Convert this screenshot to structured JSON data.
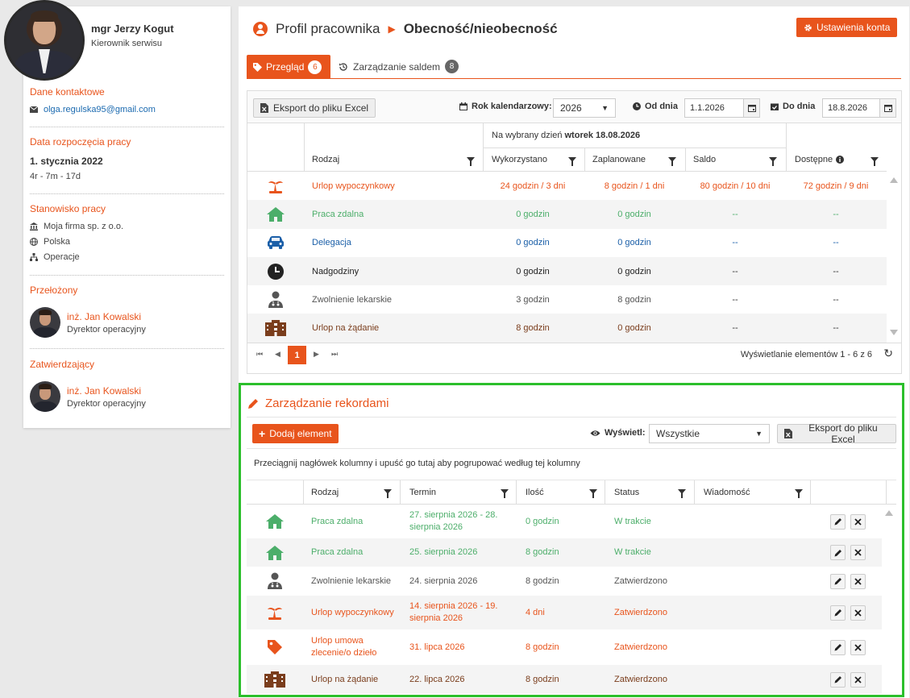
{
  "profile": {
    "name": "mgr Jerzy Kogut",
    "role": "Kierownik serwisu",
    "contact_title": "Dane kontaktowe",
    "email": "olga.regulska95@gmail.com",
    "start_title": "Data rozpoczęcia pracy",
    "start_date": "1. stycznia 2022",
    "tenure": "4r - 7m - 17d",
    "position_title": "Stanowisko pracy",
    "company": "Moja firma sp. z o.o.",
    "country": "Polska",
    "department": "Operacje",
    "supervisor_title": "Przełożony",
    "supervisor_name": "inż. Jan Kowalski",
    "supervisor_role": "Dyrektor operacyjny",
    "approver_title": "Zatwierdzający",
    "approver_name": "inż. Jan Kowalski",
    "approver_role": "Dyrektor operacyjny"
  },
  "header": {
    "section": "Profil pracownika",
    "page": "Obecność/nieobecność",
    "settings_label": "Ustawienia konta"
  },
  "tabs": {
    "overview_label": "Przegląd",
    "overview_count": "6",
    "balance_label": "Zarządzanie saldem",
    "balance_count": "8"
  },
  "overview": {
    "export_label": "Eksport do pliku Excel",
    "year_label": "Rok kalendarzowy:",
    "year_value": "2026",
    "from_label": "Od dnia",
    "from_value": "1.1.2026",
    "to_label": "Do dnia",
    "to_value": "18.8.2026",
    "day_prefix": "Na wybrany dzień ",
    "day_value": "wtorek 18.08.2026",
    "columns": [
      "Rodzaj",
      "Wykorzystano",
      "Zaplanowane",
      "Saldo",
      "Dostępne"
    ],
    "rows": [
      {
        "icon": "palm-tree-icon",
        "color": "#e8541c",
        "name": "Urlop wypoczynkowy",
        "used": "24 godzin / 3 dni",
        "planned": "8 godzin / 1 dni",
        "balance": "80 godzin / 10 dni",
        "available": "72 godzin / 9 dni"
      },
      {
        "icon": "house-icon",
        "color": "#4cae6a",
        "name": "Praca zdalna",
        "used": "0 godzin",
        "planned": "0 godzin",
        "balance": "--",
        "available": "--"
      },
      {
        "icon": "car-icon",
        "color": "#1b5fa8",
        "name": "Delegacja",
        "used": "0 godzin",
        "planned": "0 godzin",
        "balance": "--",
        "available": "--"
      },
      {
        "icon": "clock-icon",
        "color": "#222222",
        "name": "Nadgodziny",
        "used": "0 godzin",
        "planned": "0 godzin",
        "balance": "--",
        "available": "--"
      },
      {
        "icon": "doctor-icon",
        "color": "#555555",
        "name": "Zwolnienie lekarskie",
        "used": "3 godzin",
        "planned": "8 godzin",
        "balance": "--",
        "available": "--"
      },
      {
        "icon": "hotel-icon",
        "color": "#7a3d1c",
        "name": "Urlop na żądanie",
        "used": "8 godzin",
        "planned": "0 godzin",
        "balance": "--",
        "available": "--"
      }
    ],
    "current_page": "1",
    "page_info": "Wyświetlanie elementów 1 - 6 z 6"
  },
  "records": {
    "title": "Zarządzanie rekordami",
    "add_label": "Dodaj element",
    "show_label": "Wyświetl:",
    "show_value": "Wszystkie",
    "export_label": "Eksport do pliku Excel",
    "group_hint": "Przeciągnij nagłówek kolumny i upuść go tutaj aby pogrupować według tej kolumny",
    "columns": [
      "Rodzaj",
      "Termin",
      "Ilość",
      "Status",
      "Wiadomość"
    ],
    "rows": [
      {
        "icon": "house-icon",
        "color": "#4cae6a",
        "name": "Praca zdalna",
        "term": "27. sierpnia 2026 - 28. sierpnia 2026",
        "qty": "0 godzin",
        "status": "W trakcie"
      },
      {
        "icon": "house-icon",
        "color": "#4cae6a",
        "name": "Praca zdalna",
        "term": "25. sierpnia 2026",
        "qty": "8 godzin",
        "status": "W trakcie"
      },
      {
        "icon": "doctor-icon",
        "color": "#555555",
        "name": "Zwolnienie lekarskie",
        "term": "24. sierpnia 2026",
        "qty": "8 godzin",
        "status": "Zatwierdzono"
      },
      {
        "icon": "palm-tree-icon",
        "color": "#e8541c",
        "name": "Urlop wypoczynkowy",
        "term": "14. sierpnia 2026 - 19. sierpnia 2026",
        "qty": "4 dni",
        "status": "Zatwierdzono"
      },
      {
        "icon": "tag-icon",
        "color": "#e8541c",
        "name": "Urlop umowa zlecenie/o dzieło",
        "term": "31. lipca 2026",
        "qty": "8 godzin",
        "status": "Zatwierdzono"
      },
      {
        "icon": "hotel-icon",
        "color": "#7a3d1c",
        "name": "Urlop na żądanie",
        "term": "22. lipca 2026",
        "qty": "8 godzin",
        "status": "Zatwierdzono"
      }
    ]
  }
}
